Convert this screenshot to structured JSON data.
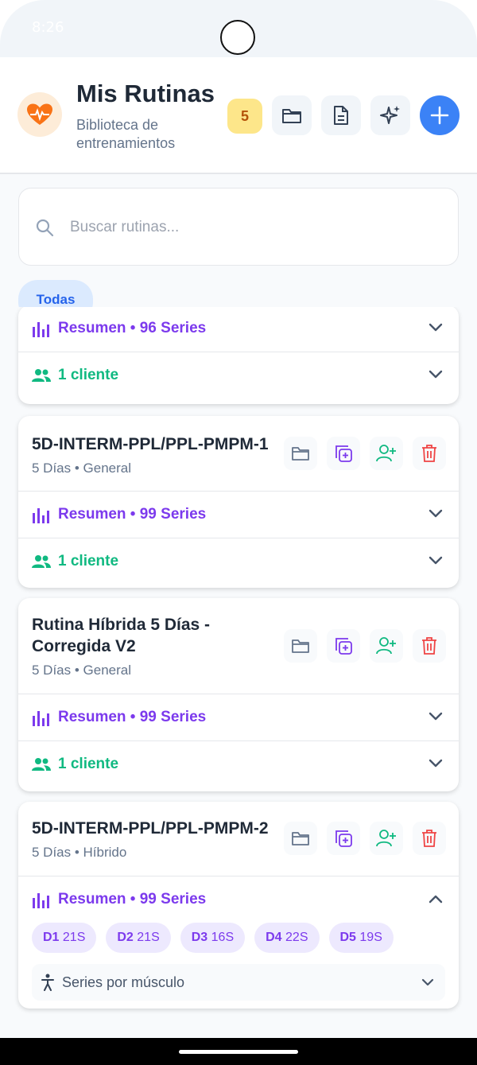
{
  "status": {
    "time": "8:26"
  },
  "header": {
    "title": "Mis Rutinas",
    "subtitle": "Biblioteca de entrenamientos",
    "count": "5",
    "accent": "#3b82f6"
  },
  "search": {
    "placeholder": "Buscar rutinas..."
  },
  "filters": {
    "active": "Todas"
  },
  "cards": [
    {
      "summary": "Resumen • 96 Series",
      "clients": "1 cliente"
    },
    {
      "title": "5D-INTERM-PPL/PPL-PMPM-1",
      "meta": "5 Días • General",
      "summary": "Resumen • 99 Series",
      "clients": "1 cliente"
    },
    {
      "title": "Rutina Híbrida 5 Días - Corregida V2",
      "meta": "5 Días • General",
      "summary": "Resumen • 99 Series",
      "clients": "1 cliente"
    },
    {
      "title": "5D-INTERM-PPL/PPL-PMPM-2",
      "meta": "5 Días • Híbrido",
      "summary": "Resumen • 99 Series",
      "days": [
        {
          "day": "D1",
          "sets": "21S"
        },
        {
          "day": "D2",
          "sets": "21S"
        },
        {
          "day": "D3",
          "sets": "16S"
        },
        {
          "day": "D4",
          "sets": "22S"
        },
        {
          "day": "D5",
          "sets": "19S"
        }
      ],
      "muscle_label": "Series por músculo"
    }
  ]
}
